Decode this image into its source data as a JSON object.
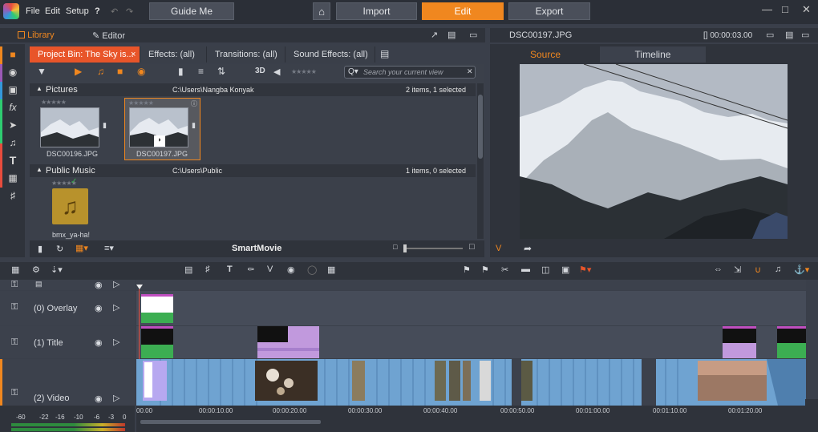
{
  "menu": {
    "file": "File",
    "edit": "Edit",
    "setup": "Setup"
  },
  "nav": {
    "guide": "Guide Me",
    "import": "Import",
    "edit": "Edit",
    "export": "Export"
  },
  "left_panel": {
    "library_tab": "Library",
    "editor_tab": "Editor"
  },
  "tabs": [
    {
      "label": "Project Bin: The Sky is..."
    },
    {
      "label": "Effects: (all)"
    },
    {
      "label": "Transitions: (all)"
    },
    {
      "label": "Sound Effects: (all)"
    }
  ],
  "toolbar": {
    "view_3d": "3D",
    "search_placeholder": "Search your current view"
  },
  "groups": [
    {
      "name": "Pictures",
      "path": "C:\\Users\\Nangba Konyak",
      "status": "2 items, 1 selected"
    },
    {
      "name": "Public Music",
      "path": "C:\\Users\\Public",
      "status": "1 items, 0 selected"
    }
  ],
  "items": [
    {
      "name": "DSC00196.JPG"
    },
    {
      "name": "DSC00197.JPG"
    },
    {
      "name": "bmx_ya-ha!"
    }
  ],
  "bottom_bar": {
    "smartmovie": "SmartMovie"
  },
  "preview": {
    "title": "DSC00197.JPG",
    "timecode": "[] 00:00:03.00",
    "source_tab": "Source",
    "timeline_tab": "Timeline",
    "v_label": "V"
  },
  "tracks": [
    {
      "label": "(0) Overlay"
    },
    {
      "label": "(1) Title"
    },
    {
      "label": "(2) Video"
    }
  ],
  "meter": {
    "labels": [
      "-60",
      "-22",
      "-16",
      "-10",
      "-6",
      "-3",
      "0"
    ]
  },
  "ruler": {
    "ticks": [
      "00.00",
      "00:00:10.00",
      "00:00:20.00",
      "00:00:30.00",
      "00:00:40.00",
      "00:00:50.00",
      "00:01:00.00",
      "00:01:10.00",
      "00:01:20.00"
    ]
  },
  "colors": {
    "accent": "#f0871f",
    "active_tab": "#e8552a",
    "clip_blue": "#6fa3d1",
    "title_purple": "#c199dd",
    "clip_green": "#3cae52"
  }
}
